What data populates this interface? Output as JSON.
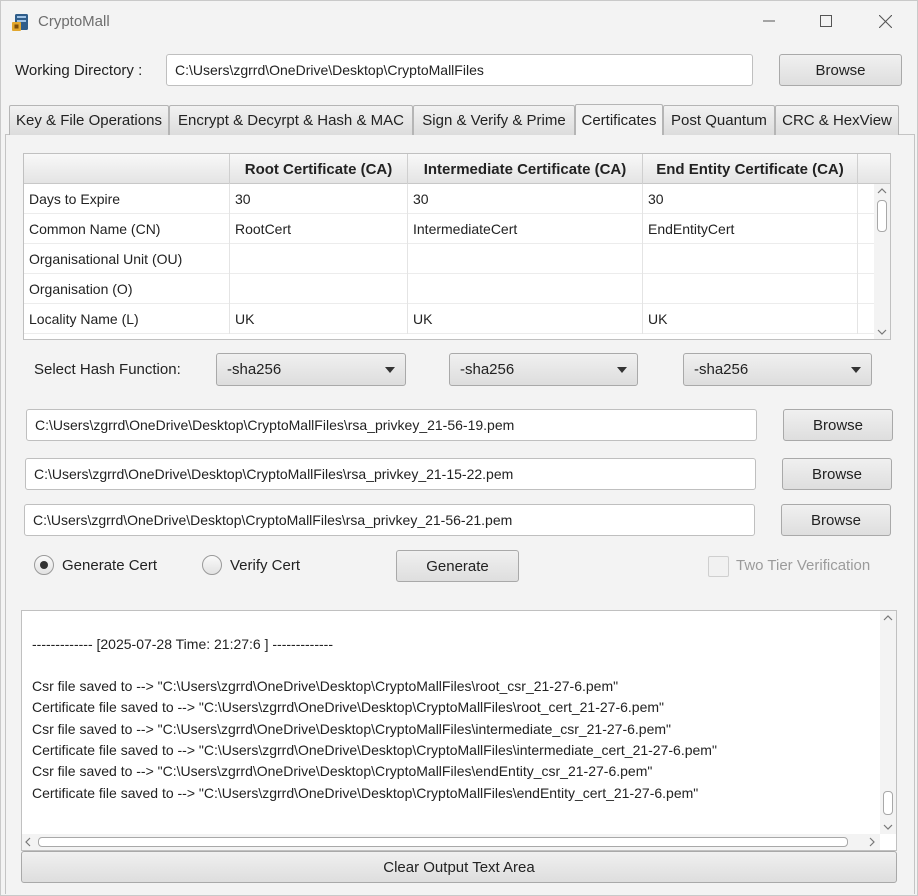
{
  "window": {
    "title": "CryptoMall",
    "icons": [
      "app-icon",
      "minimize-icon",
      "maximize-icon",
      "close-icon"
    ]
  },
  "working_directory": {
    "label": "Working Directory :",
    "value": "C:\\Users\\zgrrd\\OneDrive\\Desktop\\CryptoMallFiles",
    "browse_label": "Browse"
  },
  "tabs": [
    {
      "label": "Key & File Operations"
    },
    {
      "label": "Encrypt & Decyrpt & Hash & MAC"
    },
    {
      "label": "Sign & Verify & Prime"
    },
    {
      "label": "Certificates",
      "active": true
    },
    {
      "label": "Post Quantum"
    },
    {
      "label": "CRC & HexView"
    }
  ],
  "table": {
    "headers": [
      "",
      "Root Certificate (CA)",
      "Intermediate Certificate (CA)",
      "End Entity Certificate (CA)"
    ],
    "rows": [
      [
        "Days to Expire",
        "30",
        "30",
        "30"
      ],
      [
        "Common Name (CN)",
        "RootCert",
        "IntermediateCert",
        "EndEntityCert"
      ],
      [
        "Organisational Unit (OU)",
        "",
        "",
        ""
      ],
      [
        "Organisation (O)",
        "",
        "",
        ""
      ],
      [
        "Locality Name (L)",
        "UK",
        "UK",
        "UK"
      ]
    ]
  },
  "hash": {
    "label": "Select Hash Function:",
    "selects": [
      "-sha256",
      "-sha256",
      "-sha256"
    ]
  },
  "key_files": [
    {
      "value": "C:\\Users\\zgrrd\\OneDrive\\Desktop\\CryptoMallFiles\\rsa_privkey_21-56-19.pem",
      "browse_label": "Browse"
    },
    {
      "value": "C:\\Users\\zgrrd\\OneDrive\\Desktop\\CryptoMallFiles\\rsa_privkey_21-15-22.pem",
      "browse_label": "Browse"
    },
    {
      "value": "C:\\Users\\zgrrd\\OneDrive\\Desktop\\CryptoMallFiles\\rsa_privkey_21-56-21.pem",
      "browse_label": "Browse"
    }
  ],
  "mode": {
    "generate_label": "Generate Cert",
    "verify_label": "Verify Cert",
    "selected": "generate",
    "action_label": "Generate",
    "two_tier_label": "Two Tier Verification",
    "two_tier_enabled": false
  },
  "output": {
    "lines": [
      "------------- [2025-07-28 Time: 21:27:6 ] -------------",
      "",
      "Csr file saved to --> \"C:\\Users\\zgrrd\\OneDrive\\Desktop\\CryptoMallFiles\\root_csr_21-27-6.pem\"",
      "Certificate file saved to --> \"C:\\Users\\zgrrd\\OneDrive\\Desktop\\CryptoMallFiles\\root_cert_21-27-6.pem\"",
      "Csr file saved to --> \"C:\\Users\\zgrrd\\OneDrive\\Desktop\\CryptoMallFiles\\intermediate_csr_21-27-6.pem\"",
      "Certificate file saved to --> \"C:\\Users\\zgrrd\\OneDrive\\Desktop\\CryptoMallFiles\\intermediate_cert_21-27-6.pem\"",
      "Csr file saved to --> \"C:\\Users\\zgrrd\\OneDrive\\Desktop\\CryptoMallFiles\\endEntity_csr_21-27-6.pem\"",
      "Certificate file saved to --> \"C:\\Users\\zgrrd\\OneDrive\\Desktop\\CryptoMallFiles\\endEntity_cert_21-27-6.pem\""
    ],
    "clear_label": "Clear Output Text Area"
  }
}
